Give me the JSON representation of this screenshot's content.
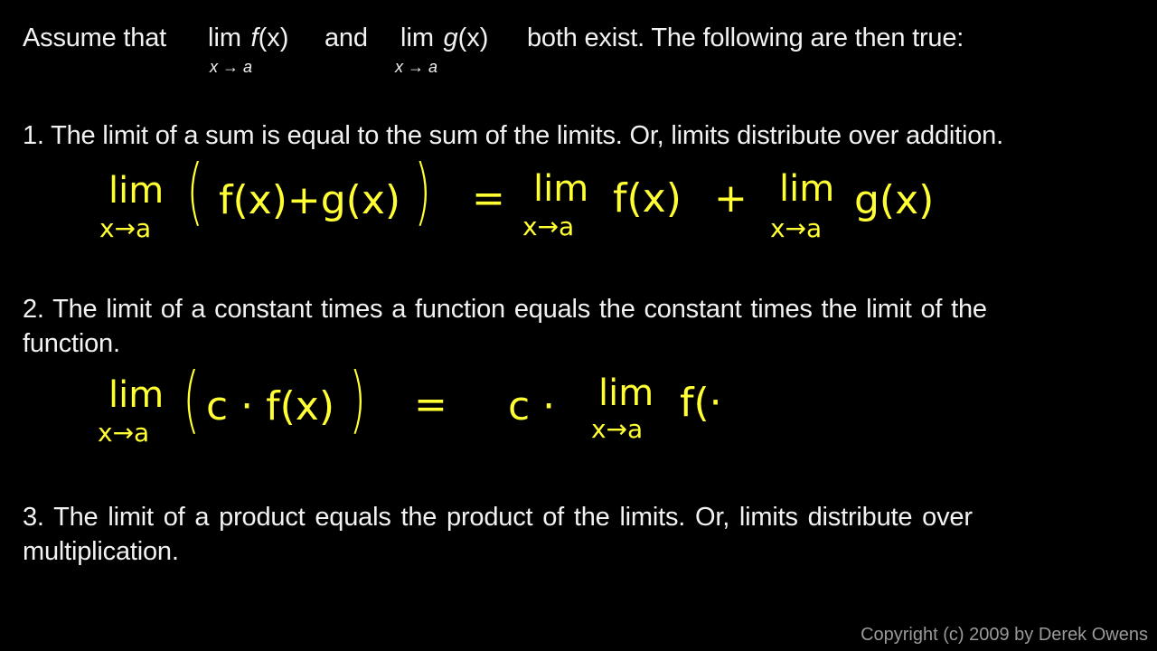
{
  "intro": {
    "prefix": "Assume that",
    "lim1_word": "lim",
    "lim1_sub": "x → a",
    "lim1_func": "f",
    "lim1_arg": "(x)",
    "and_word": "and",
    "lim2_word": "lim",
    "lim2_sub": "x → a",
    "lim2_func": "g",
    "lim2_arg": "(x)",
    "suffix": "both exist.  The following are then true:"
  },
  "rules": [
    {
      "text": "1.  The limit of a sum is equal to the sum of the limits.  Or, limits distribute over addition.",
      "handwritten": {
        "lhs_lim": "lim",
        "lhs_sub": "x→a",
        "lhs_open": "(",
        "lhs_expr": "f(x)+g(x)",
        "lhs_close": ")",
        "equals": "=",
        "rhs1_lim": "lim",
        "rhs1_sub": "x→a",
        "rhs1_expr": "f(x)",
        "plus": "+",
        "rhs2_lim": "lim",
        "rhs2_sub": "x→a",
        "rhs2_expr": "g(x)"
      }
    },
    {
      "text_line1": "2.  The limit of a constant times a function equals the constant times the limit of the",
      "text_line2": "function.",
      "handwritten": {
        "lhs_lim": "lim",
        "lhs_sub": "x→a",
        "lhs_open": "(",
        "lhs_expr": "c · f(x)",
        "lhs_close": ")",
        "equals": "=",
        "rhs_const": "c ·",
        "rhs_lim": "lim",
        "rhs_sub": "x→a",
        "rhs_expr": "f(·"
      }
    },
    {
      "text_line1": "3.  The limit of a product equals the product of the limits.  Or, limits distribute over",
      "text_line2": "multiplication."
    }
  ],
  "footer": {
    "copyright": "Copyright (c) 2009 by Derek Owens"
  },
  "colors": {
    "background": "#000000",
    "text": "#f2f2f2",
    "handwriting": "#ffff33",
    "copyright": "#9a9a9a"
  }
}
